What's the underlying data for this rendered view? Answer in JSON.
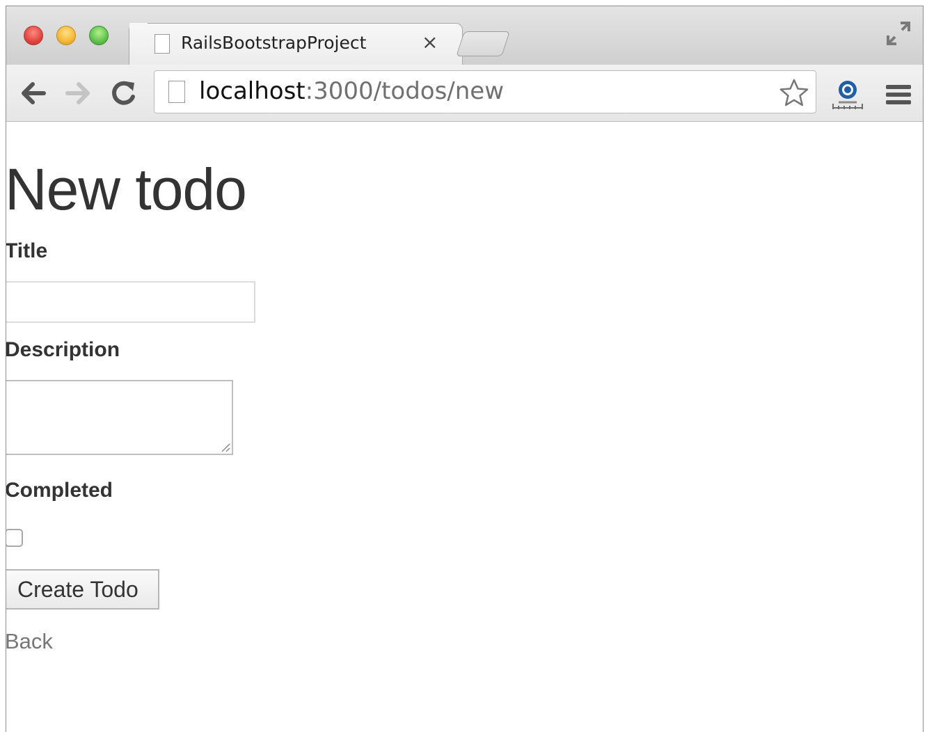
{
  "browser": {
    "tab": {
      "title": "RailsBootstrapProject",
      "close_symbol": "×"
    },
    "url": {
      "host": "localhost",
      "rest": ":3000/todos/new"
    }
  },
  "page": {
    "heading": "New todo",
    "form": {
      "title_label": "Title",
      "title_value": "",
      "description_label": "Description",
      "description_value": "",
      "completed_label": "Completed",
      "completed_checked": false,
      "submit_label": "Create Todo"
    },
    "back_link": "Back"
  },
  "icons": {
    "back": "arrow-left-icon",
    "forward": "arrow-right-icon",
    "reload": "reload-icon",
    "bookmark": "star-icon",
    "extension": "extension-icon",
    "menu": "hamburger-menu-icon",
    "fullscreen": "fullscreen-icon"
  }
}
